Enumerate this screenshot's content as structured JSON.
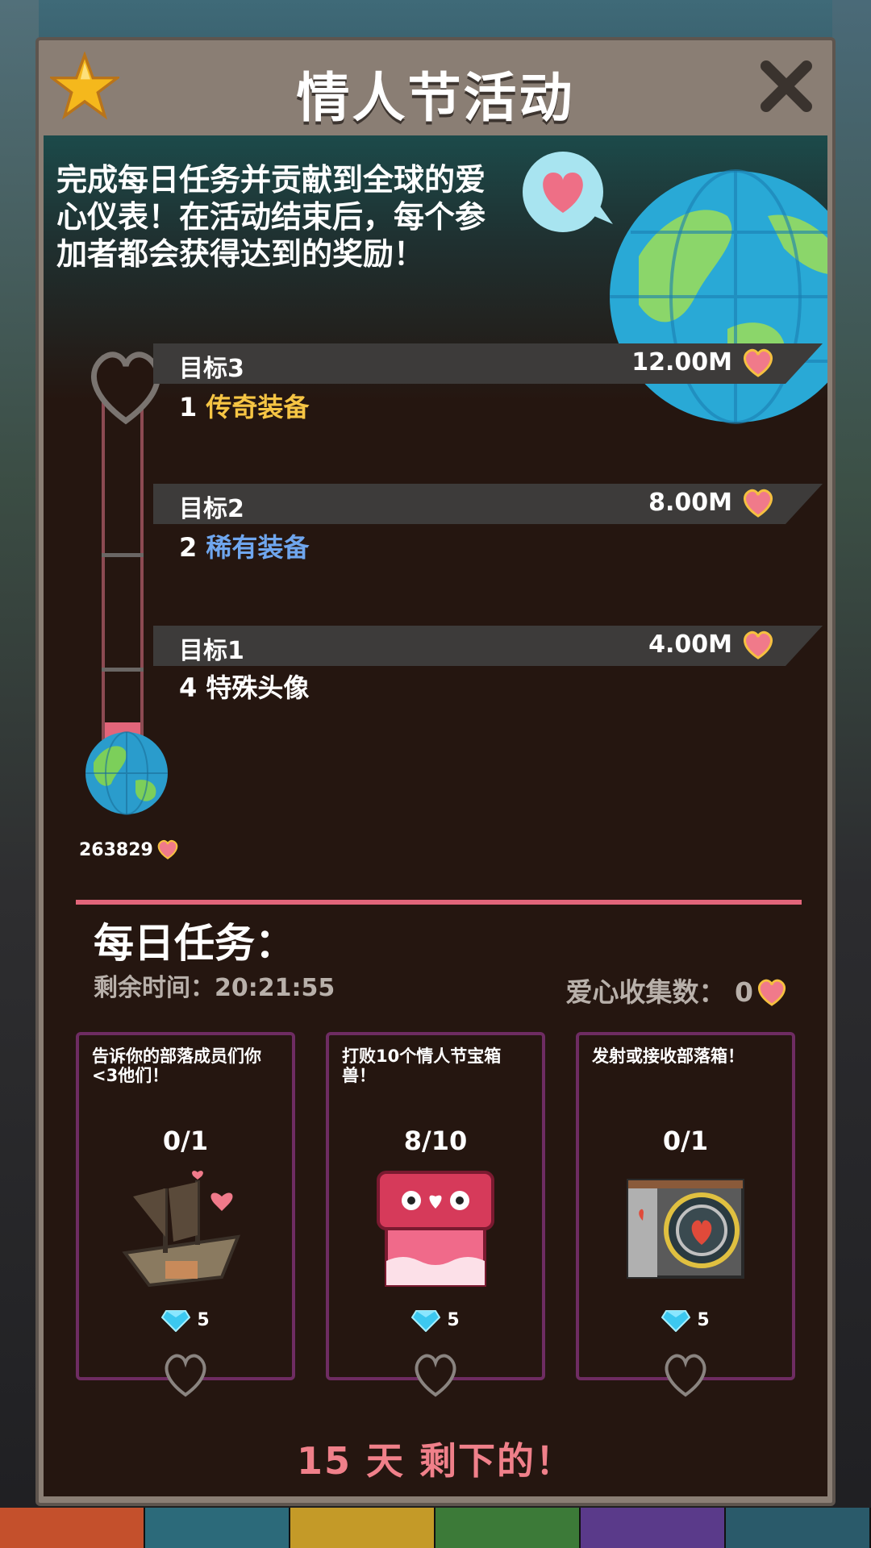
{
  "header": {
    "title": "情人节活动"
  },
  "intro": {
    "text": "完成每日任务并贡献到全球的爱心仪表！在活动结束后，每个参加者都会获得达到的奖励！"
  },
  "meter": {
    "count": "263829",
    "fill_fraction": 0.066
  },
  "goals": [
    {
      "label": "目标3",
      "amount": "12.00M",
      "reward_count": "1",
      "reward_name": "传奇装备",
      "reward_color": "#f6c544"
    },
    {
      "label": "目标2",
      "amount": "8.00M",
      "reward_count": "2",
      "reward_name": "稀有装备",
      "reward_color": "#6fa6ee"
    },
    {
      "label": "目标1",
      "amount": "4.00M",
      "reward_count": "4",
      "reward_name": "特殊头像",
      "reward_color": "#ffffff"
    }
  ],
  "daily": {
    "title": "每日任务：",
    "remaining_label": "剩余时间：",
    "remaining_time": "20:21:55",
    "collected_label": "爱心收集数：",
    "collected_value": "0"
  },
  "tasks": [
    {
      "desc": "告诉你的部落成员们你<3他们！",
      "progress": "0/1",
      "reward": "5",
      "art": "ship-icon"
    },
    {
      "desc": "打败10个情人节宝箱兽！",
      "progress": "8/10",
      "reward": "5",
      "art": "chest-monster-icon"
    },
    {
      "desc": "发射或接收部落箱！",
      "progress": "0/1",
      "reward": "5",
      "art": "clan-box-icon"
    }
  ],
  "footer": {
    "days_left": "15 天 剩下的！"
  },
  "colors": {
    "accent_pink": "#e2657a",
    "task_border": "#6e2c62",
    "panel_bg": "#251610"
  }
}
